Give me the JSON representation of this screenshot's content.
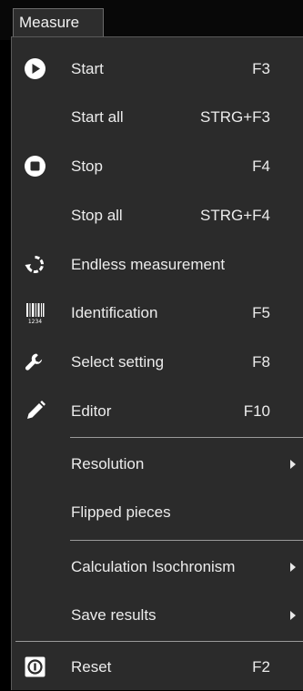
{
  "menubar": {
    "title": "Measure"
  },
  "menu": {
    "start": {
      "label": "Start",
      "shortcut": "F3",
      "icon": "play-circle-icon"
    },
    "start_all": {
      "label": "Start all",
      "shortcut": "STRG+F3"
    },
    "stop": {
      "label": "Stop",
      "shortcut": "F4",
      "icon": "stop-circle-icon"
    },
    "stop_all": {
      "label": "Stop all",
      "shortcut": "STRG+F4"
    },
    "endless": {
      "label": "Endless measurement",
      "icon": "endless-loop-icon"
    },
    "identification": {
      "label": "Identification",
      "shortcut": "F5",
      "icon": "barcode-icon",
      "icon_caption": "1234"
    },
    "select_setting": {
      "label": "Select setting",
      "shortcut": "F8",
      "icon": "wrench-icon"
    },
    "editor": {
      "label": "Editor",
      "shortcut": "F10",
      "icon": "pencil-icon"
    },
    "resolution": {
      "label": "Resolution",
      "submenu": true
    },
    "flipped_pieces": {
      "label": "Flipped pieces"
    },
    "calc_isochronism": {
      "label": "Calculation Isochronism",
      "submenu": true
    },
    "save_results": {
      "label": "Save results",
      "submenu": true
    },
    "reset": {
      "label": "Reset",
      "shortcut": "F2",
      "icon": "reset-icon"
    }
  },
  "colors": {
    "background": "#000000",
    "menu_background": "#2b2b2b",
    "text": "#ececec",
    "separator": "#9a9a9a"
  }
}
